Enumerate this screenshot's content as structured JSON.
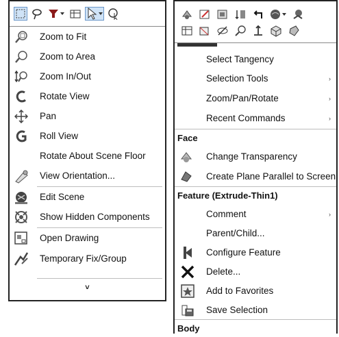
{
  "left_menu": {
    "toolbar_icons": [
      "box-select-icon",
      "lasso-icon",
      "filter-icon",
      "table-icon",
      "select-arrow-icon",
      "magnify-select-icon"
    ],
    "items": [
      {
        "label": "Zoom to Fit",
        "icon": "zoom-fit-icon"
      },
      {
        "label": "Zoom to Area",
        "icon": "zoom-area-icon"
      },
      {
        "label": "Zoom In/Out",
        "icon": "zoom-in-out-icon"
      },
      {
        "label": "Rotate View",
        "icon": "rotate-view-icon"
      },
      {
        "label": "Pan",
        "icon": "pan-icon"
      },
      {
        "label": "Roll View",
        "icon": "roll-view-icon"
      },
      {
        "label": "Rotate About Scene Floor",
        "icon": ""
      },
      {
        "label": "View Orientation...",
        "icon": "view-orientation-icon"
      },
      {
        "label": "Edit Scene",
        "icon": "edit-scene-icon"
      },
      {
        "label": "Show Hidden Components",
        "icon": "show-hidden-icon"
      },
      {
        "label": "Open Drawing",
        "icon": "open-drawing-icon"
      },
      {
        "label": "Temporary Fix/Group",
        "icon": "temp-fix-icon"
      }
    ],
    "more_glyph": "˅"
  },
  "right_menu": {
    "toolbar_row1": [
      "smart-mates-icon",
      "edit-sketch-icon",
      "display-icon",
      "relations-icon",
      "back-arrow-icon",
      "appearance-icon",
      "assembly-icon"
    ],
    "toolbar_row2": [
      "table-icon",
      "plane-icon",
      "hide-icon",
      "zoom-selection-icon",
      "normal-to-icon",
      "isometric-icon",
      "part-icon"
    ],
    "items_top": [
      {
        "label": "Select Tangency",
        "arrow": false
      },
      {
        "label": "Selection Tools",
        "arrow": true
      },
      {
        "label": "Zoom/Pan/Rotate",
        "arrow": true
      },
      {
        "label": "Recent Commands",
        "arrow": true
      }
    ],
    "header_face": "Face",
    "face_items": [
      {
        "label": "Change Transparency",
        "icon": "transparency-icon"
      },
      {
        "label": "Create Plane Parallel to Screen",
        "icon": "plane-parallel-icon"
      }
    ],
    "header_feature": "Feature (Extrude-Thin1)",
    "feature_items": [
      {
        "label": "Comment",
        "arrow": true,
        "icon": ""
      },
      {
        "label": "Parent/Child...",
        "arrow": false,
        "icon": ""
      },
      {
        "label": "Configure Feature",
        "arrow": false,
        "icon": "configure-feature-icon"
      },
      {
        "label": "Delete...",
        "arrow": false,
        "icon": "delete-icon"
      },
      {
        "label": "Add to Favorites",
        "arrow": false,
        "icon": "favorites-icon"
      },
      {
        "label": "Save Selection",
        "arrow": false,
        "icon": "save-selection-icon"
      }
    ],
    "header_body": "Body",
    "arrow_glyph": "›"
  }
}
